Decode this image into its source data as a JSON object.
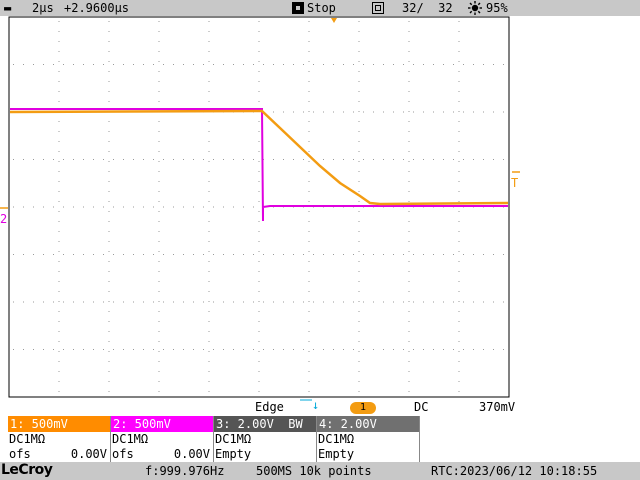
{
  "status_bar": {
    "timebase": "2μs",
    "delay": "+2.9600μs",
    "run_state": "Stop",
    "acq_count": "32/  32",
    "brightness": "95%"
  },
  "trigger_bar": {
    "type": "Edge",
    "source": "1",
    "coupling": "DC",
    "level": "370mV"
  },
  "channels": [
    {
      "header": "1: 500mV",
      "coupling": "DC1MΩ",
      "ofs_label": "ofs",
      "ofs_value": "0.00V",
      "color": "#ff8c00"
    },
    {
      "header": "2: 500mV",
      "coupling": "DC1MΩ",
      "ofs_label": "ofs",
      "ofs_value": "0.00V",
      "color": "#ff00ff"
    },
    {
      "header": "3: 2.00V  BW",
      "coupling": "DC1MΩ",
      "extra": "Empty",
      "color": "#555555"
    },
    {
      "header": "4: 2.00V",
      "coupling": "DC1MΩ",
      "extra": "Empty",
      "color": "#707070"
    }
  ],
  "bottom_bar": {
    "brand": "LeCroy",
    "frequency": "f:999.976Hz",
    "sample_info": "500MS 10k points",
    "rtc": "RTC:2023/06/12 10:18:55"
  },
  "markers": {
    "trigger_level_label": "T",
    "ch2_ground_label": "2"
  },
  "colors": {
    "ch1": "#f39c12",
    "ch2": "#e000e0",
    "grid": "#9a9a9a"
  }
}
